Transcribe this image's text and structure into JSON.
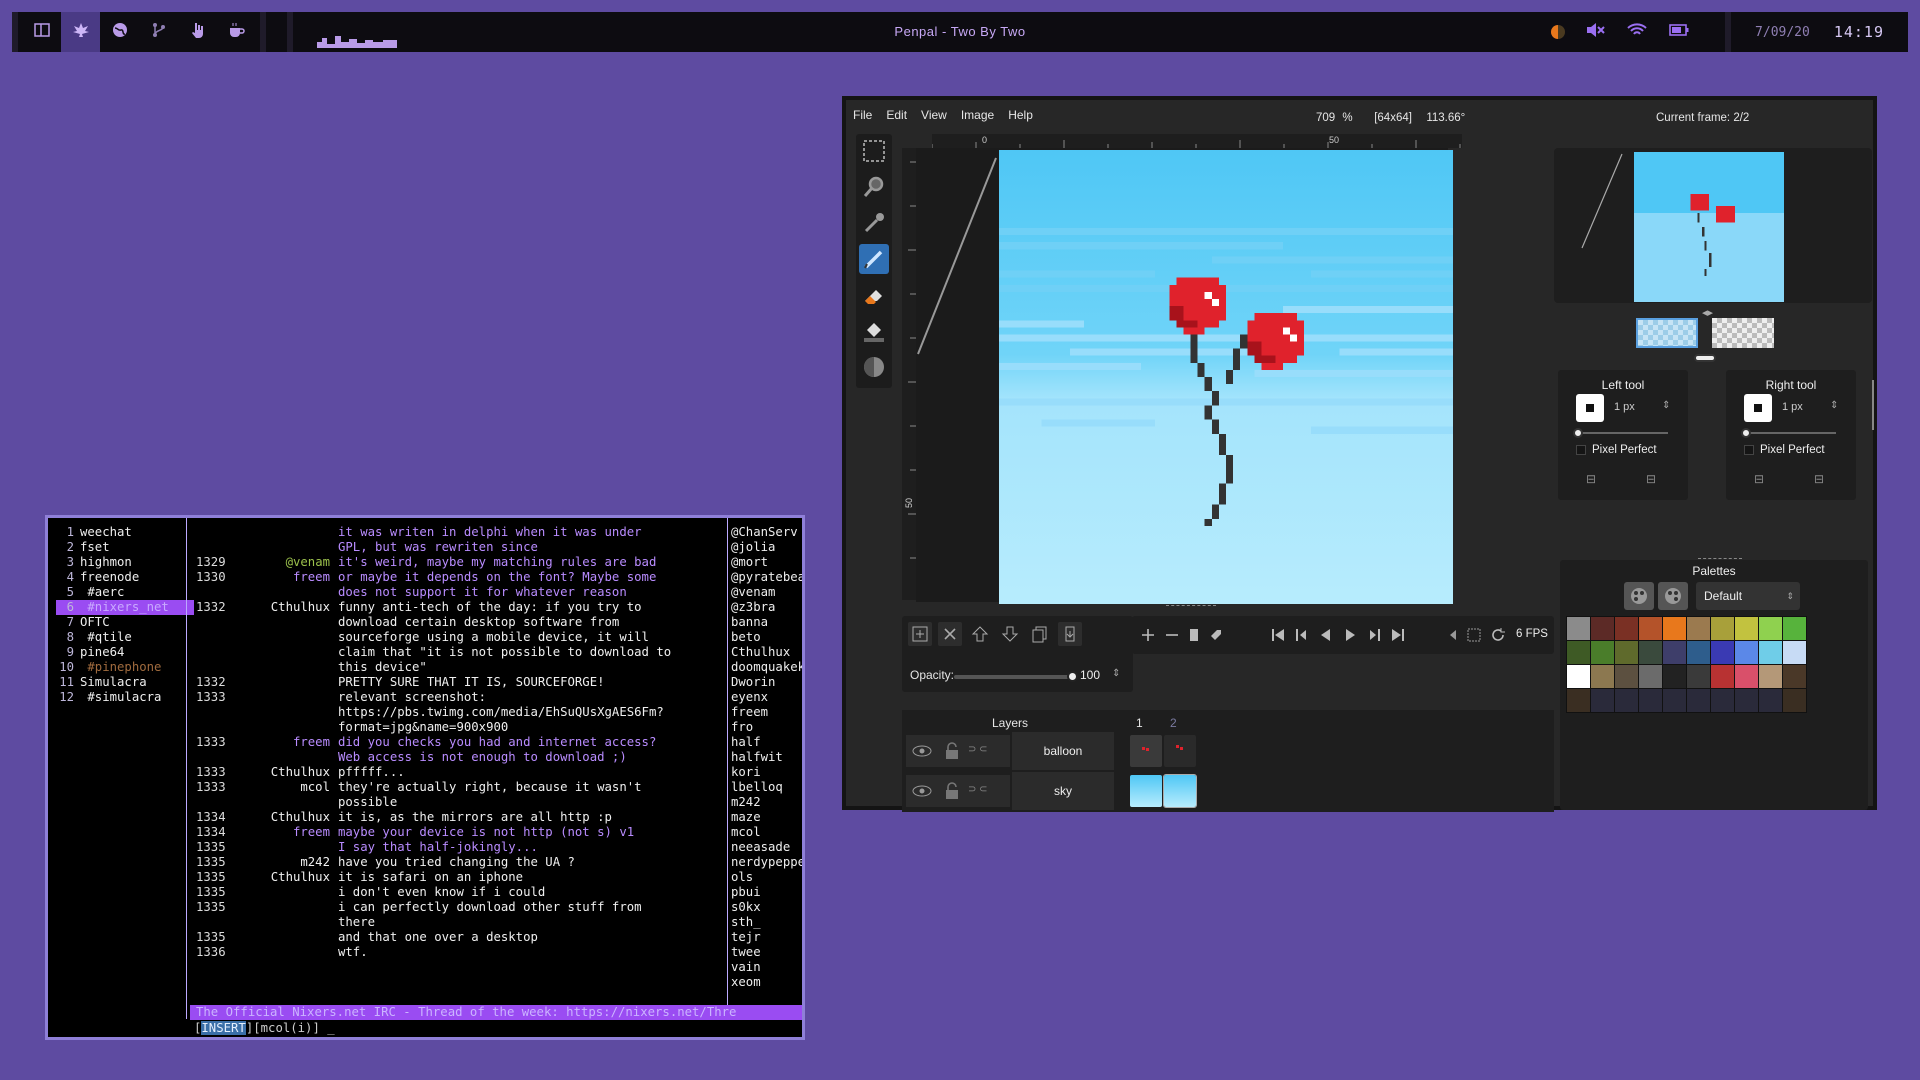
{
  "topbar": {
    "workspaces": [
      {
        "icon": "layout-icon",
        "active": false
      },
      {
        "icon": "leaf-icon",
        "active": true
      },
      {
        "icon": "globe-icon",
        "active": false
      },
      {
        "icon": "git-branch-icon",
        "active": false
      },
      {
        "icon": "hand-icon",
        "active": false
      },
      {
        "icon": "coffee-icon",
        "active": false
      }
    ],
    "title": "Penpal - Two By Two",
    "date": "7/09/20",
    "time": "14:19",
    "tray_icons": [
      "contrast-icon",
      "volume-muted-icon",
      "wifi-icon",
      "battery-icon"
    ],
    "accent": "#b99be8"
  },
  "irc": {
    "buffers": [
      {
        "n": "1",
        "name": "weechat"
      },
      {
        "n": "2",
        "name": "fset"
      },
      {
        "n": "3",
        "name": "highmon"
      },
      {
        "n": "4",
        "name": "freenode"
      },
      {
        "n": "5",
        "name": "  #aerc"
      },
      {
        "n": "6",
        "name": "  #nixers_net",
        "active": true
      },
      {
        "n": "7",
        "name": "OFTC"
      },
      {
        "n": "8",
        "name": "  #qtile"
      },
      {
        "n": "9",
        "name": "pine64"
      },
      {
        "n": "10",
        "name": "  #pinephone",
        "dim": true
      },
      {
        "n": "11",
        "name": "Simulacra"
      },
      {
        "n": "12",
        "name": "  #simulacra"
      }
    ],
    "lines": [
      {
        "ts": "",
        "nick": "",
        "msg": "it was writen in delphi when it was under GPL, but was rewriten since"
      },
      {
        "ts": "1329",
        "nick": "@venam",
        "cls": "venam",
        "msg": "it's weird, maybe my matching rules are bad"
      },
      {
        "ts": "1330",
        "nick": "freem",
        "msg": "or maybe it depends on the font? Maybe some does not support it for whatever reason"
      },
      {
        "ts": "1332",
        "nick": "Cthulhux",
        "msg": "funny anti-tech of the day: if you try to download certain desktop software from sourceforge using a mobile device, it will claim that \"it is not possible to download to this device\"",
        "me": true
      },
      {
        "ts": "1332",
        "nick": "",
        "msg": "PRETTY SURE THAT IT IS, SOURCEFORGE!",
        "me": true
      },
      {
        "ts": "1333",
        "nick": "",
        "msg": "relevant screenshot: https://pbs.twimg.com/media/EhSuQUsXgAES6Fm?format=jpg&name=900x900",
        "me": true
      },
      {
        "ts": "1333",
        "nick": "freem",
        "msg": "did you checks you had and internet access? Web access is not enough to download ;)"
      },
      {
        "ts": "1333",
        "nick": "Cthulhux",
        "msg": "pfffff...",
        "me": true
      },
      {
        "ts": "1333",
        "nick": "mcol",
        "cls": "me",
        "msg": "they're actually right, because it wasn't possible",
        "me": true
      },
      {
        "ts": "1334",
        "nick": "Cthulhux",
        "msg": "it is, as the mirrors are all http :p",
        "me": true
      },
      {
        "ts": "1334",
        "nick": "freem",
        "msg": "maybe your device is not http (not s) v1"
      },
      {
        "ts": "1335",
        "nick": "",
        "msg": "I say that half-jokingly..."
      },
      {
        "ts": "1335",
        "nick": "m242",
        "msg": "have you tried changing the UA ?",
        "me": true
      },
      {
        "ts": "1335",
        "nick": "Cthulhux",
        "msg": "it is safari on an iphone",
        "me": true
      },
      {
        "ts": "1335",
        "nick": "",
        "msg": "i don't even know if i could",
        "me": true
      },
      {
        "ts": "1335",
        "nick": "",
        "msg": "i can perfectly download other stuff from there",
        "me": true
      },
      {
        "ts": "1335",
        "nick": "",
        "msg": "and that one over a desktop",
        "me": true
      },
      {
        "ts": "1336",
        "nick": "",
        "msg": "wtf.",
        "me": true
      }
    ],
    "nicks": [
      "@ChanServ",
      "@jolia",
      "@mort",
      "@pyratebeard",
      "@venam",
      "@z3bra",
      "banna",
      "beto",
      "Cthulhux",
      "doomquakekeen",
      "Dworin",
      "eyenx",
      "freem",
      "fro",
      "half",
      "halfwit",
      "kori",
      "lbelloq",
      "m242",
      "maze",
      "mcol",
      "neeasade",
      "nerdypepper",
      "ols",
      "pbui",
      "s0kx",
      "sth_",
      "tejr",
      "twee",
      "vain",
      "xeom"
    ],
    "topic": "The Official Nixers.net IRC - Thread of the week: https://nixers.net/Thre",
    "prompt_mode": "INSERT",
    "prompt_rest": "][mcol(i)] _"
  },
  "editor": {
    "menu": [
      "File",
      "Edit",
      "View",
      "Image",
      "Help"
    ],
    "zoom": "709 %",
    "size": "[64x64]",
    "angle": "113.66°",
    "frame_label": "Current frame: 2/2",
    "ruler_top": [
      "0",
      "50"
    ],
    "ruler_left": "50",
    "opacity_label": "Opacity:",
    "opacity_value": "100",
    "fps": "6 FPS",
    "layers_label": "Layers",
    "frame_numbers": [
      "1",
      "2"
    ],
    "layers": [
      {
        "name": "balloon"
      },
      {
        "name": "sky"
      }
    ],
    "left_tool": {
      "title": "Left tool",
      "size": "1 px",
      "pixel_perfect": "Pixel Perfect"
    },
    "right_tool": {
      "title": "Right tool",
      "size": "1 px",
      "pixel_perfect": "Pixel Perfect"
    },
    "palettes_label": "Palettes",
    "palette_name": "Default",
    "palette": [
      "#8b8b8b",
      "#5c2a26",
      "#7a3024",
      "#b4532a",
      "#e8781c",
      "#9b7a4f",
      "#a8a03a",
      "#c2c23f",
      "#8fd14f",
      "#57b33c",
      "#3e5a25",
      "#4a7d2a",
      "#5f6a2c",
      "#3a4a3d",
      "#3e3e6a",
      "#2e5d8c",
      "#3a3ab3",
      "#5b88e8",
      "#6fcde8",
      "#c7dbf5",
      "#ffffff",
      "#8c7850",
      "#5c5040",
      "#6b6b6b",
      "#222222",
      "#3a3a3a",
      "#b83232",
      "#d9506a",
      "#b49878",
      "#4a3828",
      "#3a2e22",
      "#2a2a3a",
      "#2a2a3a",
      "#2a2a3a",
      "#2a2a3a",
      "#2a2a3a",
      "#2a2a3a",
      "#2a2a3a",
      "#2a2a3a",
      "#3a2e22"
    ]
  }
}
